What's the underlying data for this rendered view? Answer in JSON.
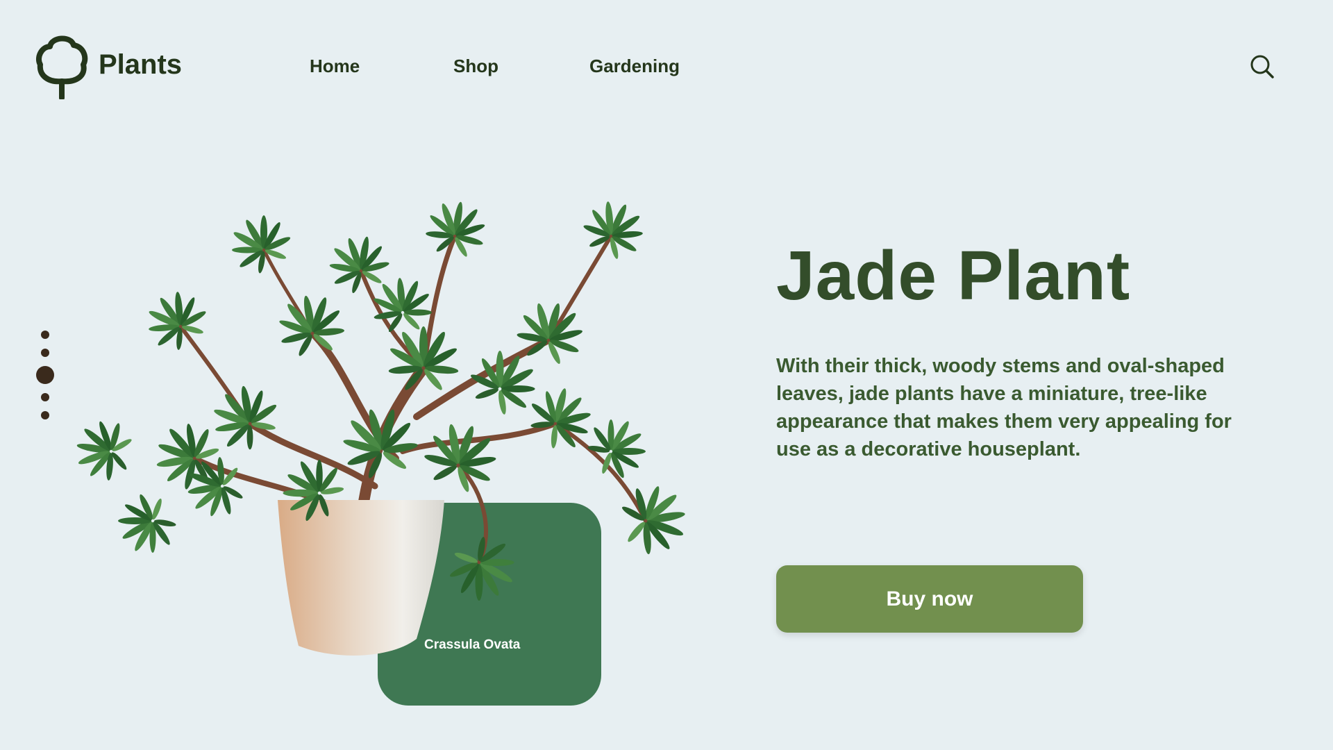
{
  "brand": {
    "name": "Plants",
    "logo_icon": "tree-icon"
  },
  "nav": {
    "items": [
      {
        "label": "Home"
      },
      {
        "label": "Shop"
      },
      {
        "label": "Gardening"
      }
    ]
  },
  "search": {
    "icon": "search-icon"
  },
  "pager": {
    "count": 5,
    "active_index": 2
  },
  "hero": {
    "title": "Jade Plant",
    "description": "With their thick, woody stems and oval-shaped leaves, jade plants have a miniature, tree-like appearance that makes them very appealing for use as a decorative houseplant.",
    "button_label": "Buy now",
    "tag_label": "Crassula Ovata"
  },
  "colors": {
    "background": "#e7eff2",
    "primary_text": "#334d2a",
    "button": "#72904e",
    "tag_card": "#3f7853",
    "dot": "#3a2a1c"
  }
}
